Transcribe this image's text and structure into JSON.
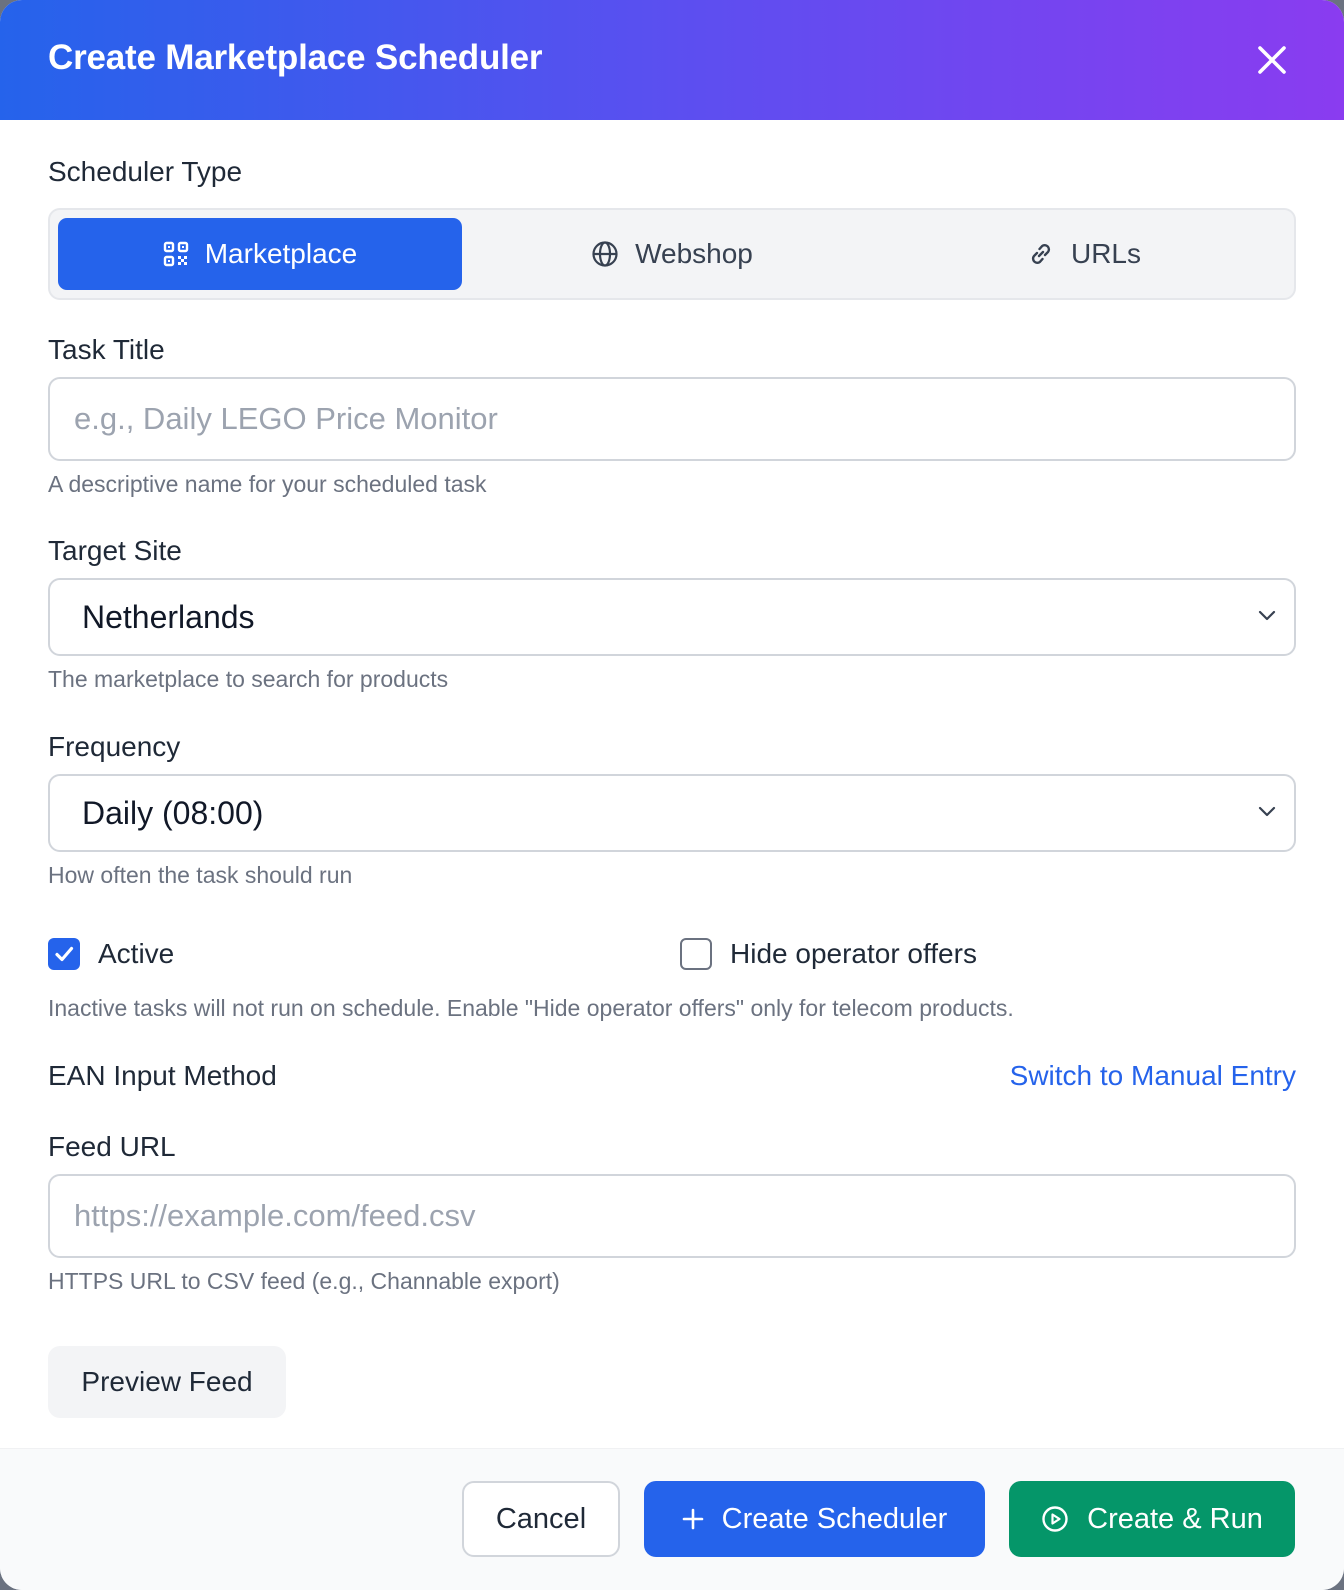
{
  "header": {
    "title": "Create Marketplace Scheduler",
    "close_icon": "close-icon"
  },
  "scheduler_type": {
    "label": "Scheduler Type",
    "options": [
      {
        "label": "Marketplace",
        "icon": "qr-grid-icon",
        "selected": true
      },
      {
        "label": "Webshop",
        "icon": "globe-icon",
        "selected": false
      },
      {
        "label": "URLs",
        "icon": "link-icon",
        "selected": false
      }
    ]
  },
  "task_title": {
    "label": "Task Title",
    "value": "",
    "placeholder": "e.g., Daily LEGO Price Monitor",
    "help": "A descriptive name for your scheduled task"
  },
  "target_site": {
    "label": "Target Site",
    "value": "Netherlands",
    "help": "The marketplace to search for products"
  },
  "frequency": {
    "label": "Frequency",
    "value": "Daily (08:00)",
    "help": "How often the task should run"
  },
  "options": {
    "active": {
      "label": "Active",
      "checked": true
    },
    "hide_operator_offers": {
      "label": "Hide operator offers",
      "checked": false
    },
    "help": "Inactive tasks will not run on schedule. Enable \"Hide operator offers\" only for telecom products."
  },
  "ean_input": {
    "label": "EAN Input Method",
    "switch_link": "Switch to Manual Entry"
  },
  "feed_url": {
    "label": "Feed URL",
    "value": "",
    "placeholder": "https://example.com/feed.csv",
    "help": "HTTPS URL to CSV feed (e.g., Channable export)",
    "preview_button": "Preview Feed"
  },
  "footer": {
    "cancel": "Cancel",
    "create": "Create Scheduler",
    "create_run": "Create & Run"
  },
  "colors": {
    "primary": "#2563eb",
    "success": "#059669",
    "header_gradient_start": "#2563eb",
    "header_gradient_end": "#8a3cf0"
  }
}
